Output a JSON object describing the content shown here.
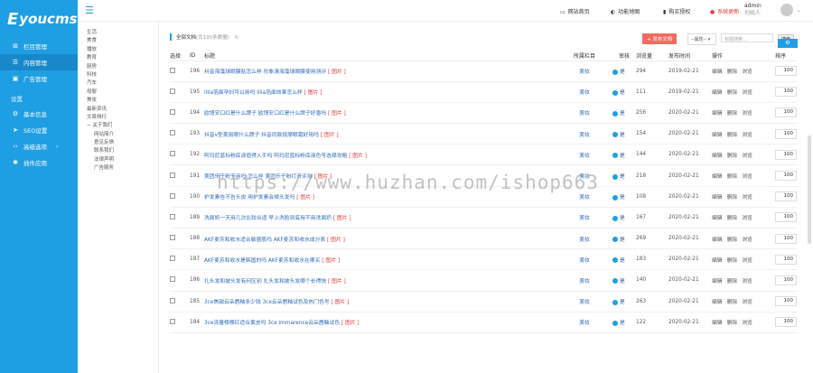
{
  "logo": {
    "letter": "E",
    "text": "youcms"
  },
  "sidebar": {
    "items": [
      {
        "label": "栏目管理",
        "icon": "sitemap-icon"
      },
      {
        "label": "内容管理",
        "icon": "list-icon",
        "active": true
      },
      {
        "label": "广告管理",
        "icon": "image-icon"
      }
    ],
    "settings_label": "设置",
    "settings_items": [
      {
        "label": "基本信息",
        "icon": "gear-icon"
      },
      {
        "label": "SEO设置",
        "icon": "send-icon"
      },
      {
        "label": "高级选项",
        "icon": "code-icon",
        "arrow": "›"
      },
      {
        "label": "插件应用",
        "icon": "plug-icon"
      }
    ]
  },
  "topbar": {
    "home": "网站首页",
    "map": "功能地图",
    "auth": "购买授权",
    "update": "系统更新",
    "admin_name": "admin",
    "admin_role": "创始人"
  },
  "catnav": [
    {
      "label": "生活",
      "sub": false
    },
    {
      "label": "美食",
      "sub": false
    },
    {
      "label": "播放",
      "sub": false
    },
    {
      "label": "教育",
      "sub": false
    },
    {
      "label": "厨房",
      "sub": false
    },
    {
      "label": "科技",
      "sub": false
    },
    {
      "label": "汽车",
      "sub": false
    },
    {
      "label": "母婴",
      "sub": false
    },
    {
      "label": "美妆",
      "sub": false
    },
    {
      "label": "最新资讯",
      "sub": false
    },
    {
      "label": "文章排行",
      "sub": false
    },
    {
      "label": "关于我们",
      "sub": false,
      "parent": true
    },
    {
      "label": "网站简介",
      "sub": true
    },
    {
      "label": "意见反馈",
      "sub": true
    },
    {
      "label": "联系我们",
      "sub": true
    },
    {
      "label": "法律声明",
      "sub": true
    },
    {
      "label": "广告服务",
      "sub": true
    }
  ],
  "toolbar": {
    "filter_label": "全部文档",
    "count_label": "(共195条数据)",
    "add_label": "+ 发布文档",
    "attr_select": "--属性--",
    "search_placeholder": "标题搜索...",
    "search_btn": "搜索"
  },
  "table": {
    "headers": [
      "选择",
      "ID",
      "标题",
      "所属栏目",
      "审核",
      "浏览量",
      "发布时间",
      "操作",
      "排序"
    ],
    "rows": [
      {
        "id": "196",
        "title": "抖音海藻球眼膜贴怎么样 形象清海藻球眼膜使用测评",
        "col": "美妆",
        "audit": "是",
        "views": "294",
        "date": "2019-02-21",
        "sort": "100"
      },
      {
        "id": "195",
        "title": "lilia箔面孕妇可以用吗 lilia箔面效果怎么样",
        "col": "美妆",
        "audit": "是",
        "views": "111",
        "date": "2019-02-21",
        "sort": "100"
      },
      {
        "id": "194",
        "title": "欧博安口红是什么牌子 欧博安口红是什么牌子好香吗",
        "col": "美妆",
        "audit": "是",
        "views": "256",
        "date": "2020-02-21",
        "sort": "100"
      },
      {
        "id": "193",
        "title": "抖音v型美丽眼什么牌子 抖音同款按摩眼霜好用吗",
        "col": "美妆",
        "audit": "是",
        "views": "154",
        "date": "2020-02-21",
        "sort": "100"
      },
      {
        "id": "192",
        "title": "阿玛尼蓝标粉底液值得入手吗 阿玛尼蓝标粉底液色号选择攻略",
        "col": "美妆",
        "audit": "是",
        "views": "144",
        "date": "2020-02-21",
        "sort": "100"
      },
      {
        "id": "191",
        "title": "美团乐于粉干用吗 怎么样 美团乐于粉打开评测",
        "col": "美妆",
        "audit": "是",
        "views": "218",
        "date": "2020-02-21",
        "sort": "100"
      },
      {
        "id": "190",
        "title": "护发素告不告头皮 用护发素会掉头发吗",
        "col": "美妆",
        "audit": "是",
        "views": "108",
        "date": "2020-02-21",
        "sort": "100"
      },
      {
        "id": "189",
        "title": "洗面奶一天用几次比较合适 早上洗脸到底用不用洗面奶",
        "col": "美妆",
        "audit": "是",
        "views": "167",
        "date": "2020-02-21",
        "sort": "100"
      },
      {
        "id": "188",
        "title": "AKF麦苏和收水适合敏感肌吗 AKF麦苏和收水成分表",
        "col": "美妆",
        "audit": "是",
        "views": "269",
        "date": "2020-02-21",
        "sort": "100"
      },
      {
        "id": "187",
        "title": "AKF麦苏和收水是韩国的吗 AKF麦苏和收水在哪买",
        "col": "美妆",
        "audit": "是",
        "views": "183",
        "date": "2020-02-21",
        "sort": "100"
      },
      {
        "id": "186",
        "title": "扎头发和披头发有何区别 扎头发和披头发哪个长得快",
        "col": "美妆",
        "audit": "是",
        "views": "140",
        "date": "2020-02-21",
        "sort": "100"
      },
      {
        "id": "185",
        "title": "3ce焦甜云朵唇釉多少钱 3ce云朵唇釉试色及热门色号",
        "col": "美妆",
        "audit": "是",
        "views": "263",
        "date": "2020-02-21",
        "sort": "100"
      },
      {
        "id": "184",
        "title": "3ce流量榜哪红适合黄皮吗 3ce immarence云朵唇釉试色",
        "col": "美妆",
        "audit": "是",
        "views": "122",
        "date": "2020-02-21",
        "sort": "100"
      }
    ],
    "img_tag": "[ 图片 ]",
    "edit": "编辑",
    "delete": "删除",
    "browse": "浏览"
  },
  "watermark": "https://www.huzhan.com/ishop663"
}
